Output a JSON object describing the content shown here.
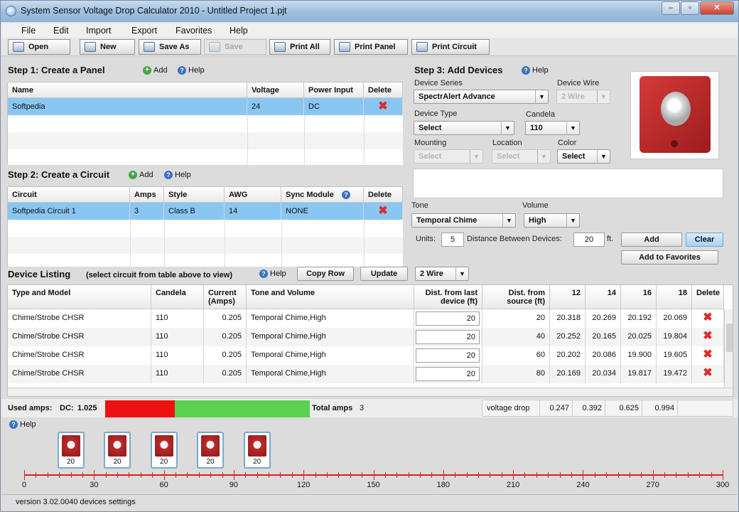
{
  "window": {
    "title": "System Sensor Voltage Drop Calculator 2010 - Untitled Project 1.pjt"
  },
  "menu": [
    "File",
    "Edit",
    "Import",
    "Export",
    "Favorites",
    "Help"
  ],
  "toolbar": {
    "open": "Open",
    "new": "New",
    "save_as": "Save As",
    "save": "Save",
    "print_all": "Print All",
    "print_panel": "Print Panel",
    "print_circuit": "Print Circuit"
  },
  "step1": {
    "title": "Step 1: Create a Panel",
    "add": "Add",
    "help": "Help",
    "columns": [
      "Name",
      "Voltage",
      "Power Input",
      "Delete"
    ],
    "rows": [
      {
        "name": "Softpedia",
        "voltage": "24",
        "power": "DC"
      }
    ]
  },
  "step2": {
    "title": "Step 2: Create a Circuit",
    "add": "Add",
    "help": "Help",
    "columns": [
      "Circuit",
      "Amps",
      "Style",
      "AWG",
      "Sync Module",
      "Delete"
    ],
    "rows": [
      {
        "circuit": "Softpedia Circuit 1",
        "amps": "3",
        "style": "Class B",
        "awg": "14",
        "sync": "NONE"
      }
    ]
  },
  "step3": {
    "title": "Step 3: Add Devices",
    "help": "Help",
    "device_series_label": "Device Series",
    "device_series": "SpectrAlert Advance",
    "device_wire_label": "Device Wire",
    "device_wire": "2 Wire",
    "device_type_label": "Device Type",
    "device_type": "Select",
    "candela_label": "Candela",
    "candela": "110",
    "mounting_label": "Mounting",
    "mounting": "Select",
    "location_label": "Location",
    "location": "Select",
    "color_label": "Color",
    "color": "Select",
    "tone_label": "Tone",
    "tone": "Temporal Chime",
    "volume_label": "Volume",
    "volume": "High",
    "units_label": "Units:",
    "units": "5",
    "distance_label": "Distance Between Devices:",
    "distance": "20",
    "ft": "ft.",
    "add": "Add",
    "clear": "Clear",
    "add_favorites": "Add to Favorites"
  },
  "listing": {
    "title": "Device Listing",
    "hint": "(select circuit from table above to view)",
    "help": "Help",
    "copy_row": "Copy Row",
    "update": "Update",
    "wire": "2 Wire",
    "columns": [
      "Type and Model",
      "Candela",
      "Current (Amps)",
      "Tone and Volume",
      "Dist. from last device (ft)",
      "Dist. from source (ft)",
      "12",
      "14",
      "16",
      "18",
      "Delete"
    ],
    "rows": [
      {
        "model": "Chime/Strobe CHSR",
        "candela": "110",
        "current": "0.205",
        "tone": "Temporal Chime,High",
        "dlast": "20",
        "dsrc": "20",
        "c12": "20.318",
        "c14": "20.269",
        "c16": "20.192",
        "c18": "20.069"
      },
      {
        "model": "Chime/Strobe CHSR",
        "candela": "110",
        "current": "0.205",
        "tone": "Temporal Chime,High",
        "dlast": "20",
        "dsrc": "40",
        "c12": "20.252",
        "c14": "20.165",
        "c16": "20.025",
        "c18": "19.804"
      },
      {
        "model": "Chime/Strobe CHSR",
        "candela": "110",
        "current": "0.205",
        "tone": "Temporal Chime,High",
        "dlast": "20",
        "dsrc": "60",
        "c12": "20.202",
        "c14": "20.086",
        "c16": "19.900",
        "c18": "19.605"
      },
      {
        "model": "Chime/Strobe CHSR",
        "candela": "110",
        "current": "0.205",
        "tone": "Temporal Chime,High",
        "dlast": "20",
        "dsrc": "80",
        "c12": "20.169",
        "c14": "20.034",
        "c16": "19.817",
        "c18": "19.472"
      }
    ]
  },
  "summary": {
    "used_label": "Used amps:",
    "dc_label": "DC:",
    "used": "1.025",
    "used_fraction": 0.342,
    "total_label": "Total amps",
    "total": "3",
    "vd_label": "voltage drop",
    "vd": [
      "0.247",
      "0.392",
      "0.625",
      "0.994"
    ],
    "used_color": "#ee1111",
    "free_color": "#5bd150"
  },
  "timeline": {
    "help": "Help",
    "devices": [
      "20",
      "20",
      "20",
      "20",
      "20"
    ],
    "ticks": [
      "0",
      "30",
      "60",
      "90",
      "120",
      "150",
      "180",
      "210",
      "240",
      "270",
      "300"
    ]
  },
  "status": "version 3.02.0040 devices  settings"
}
